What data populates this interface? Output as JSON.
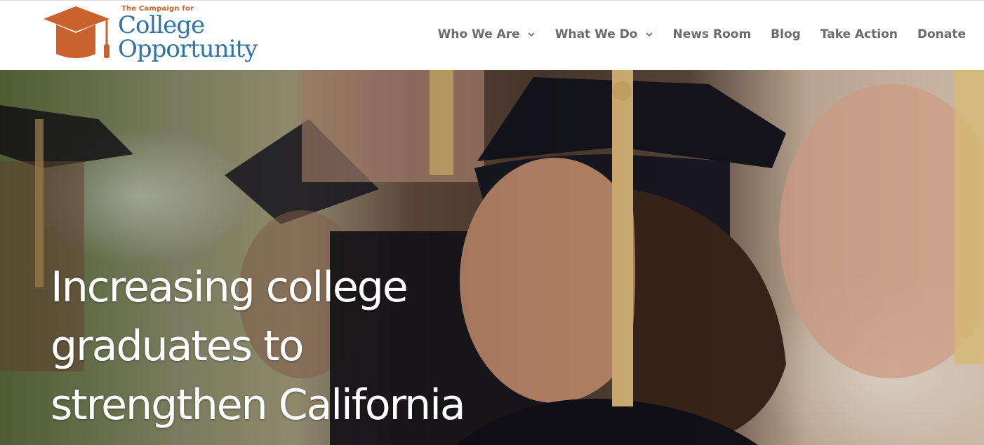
{
  "logo": {
    "kicker": "The Campaign for",
    "line1": "College",
    "line2": "Opportunity"
  },
  "nav": {
    "items": [
      {
        "label": "Who We Are",
        "has_dropdown": true
      },
      {
        "label": "What We Do",
        "has_dropdown": true
      },
      {
        "label": "News Room",
        "has_dropdown": false
      },
      {
        "label": "Blog",
        "has_dropdown": false
      },
      {
        "label": "Take Action",
        "has_dropdown": false
      },
      {
        "label": "Donate",
        "has_dropdown": false
      }
    ]
  },
  "hero": {
    "headline_lines": [
      "Increasing college",
      "graduates to",
      "strengthen California"
    ]
  },
  "colors": {
    "brand_orange": "#c9622e",
    "brand_blue": "#2f74a8",
    "nav_text": "#6b6b6b"
  },
  "icons": [
    "graduation-cap-logo-icon",
    "chevron-down-icon"
  ]
}
